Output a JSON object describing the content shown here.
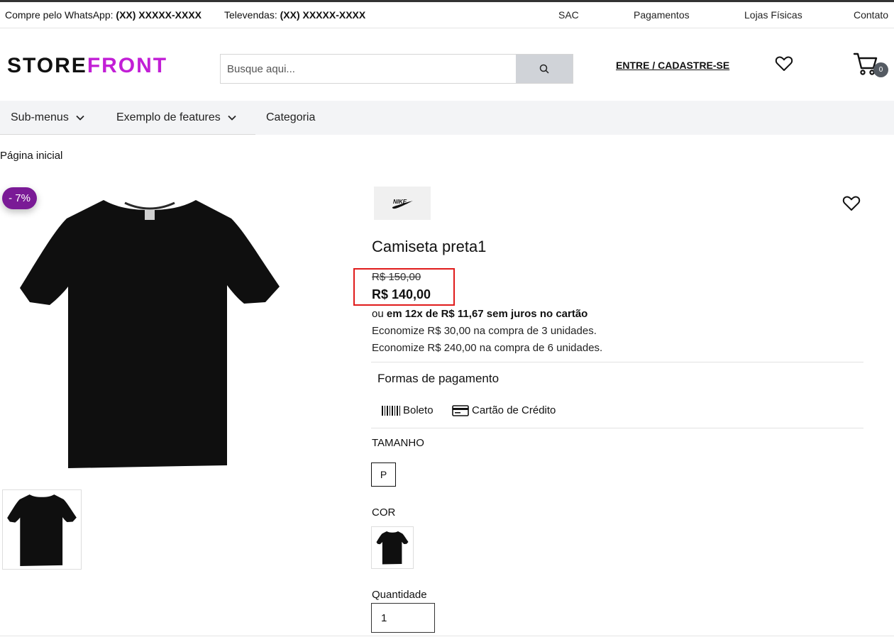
{
  "topbar": {
    "whatsapp_label": "Compre pelo WhatsApp:",
    "whatsapp_number": "(XX) XXXXX-XXXX",
    "televendas_label": "Televendas:",
    "televendas_number": "(XX) XXXXX-XXXX",
    "links": [
      "SAC",
      "Pagamentos",
      "Lojas Físicas",
      "Contato"
    ]
  },
  "header": {
    "logo_part1": "STORE",
    "logo_part2": "FRONT",
    "search_placeholder": "Busque aqui...",
    "login_label": "ENTRE / CADASTRE-SE",
    "cart_count": "0",
    "brand_color": "#c21fd6"
  },
  "menu": {
    "items": [
      {
        "label": "Sub-menus",
        "has_dropdown": true
      },
      {
        "label": "Exemplo de features",
        "has_dropdown": true
      },
      {
        "label": "Categoria",
        "has_dropdown": false
      }
    ]
  },
  "breadcrumb": "Página inicial",
  "product": {
    "discount_badge": "- 7%",
    "discount_color": "#7a1a96",
    "brand_logo": "NIKE",
    "title": "Camiseta preta1",
    "old_price": "R$ 150,00",
    "price": "R$ 140,00",
    "installments_prefix": "ou",
    "installments_text": "em 12x de R$ 11,67 sem juros no cartão",
    "savings": [
      "Economize R$ 30,00 na compra de 3 unidades.",
      "Economize R$ 240,00 na compra de 6 unidades."
    ],
    "payment_title": "Formas de pagamento",
    "payment_methods": [
      {
        "label": "Boleto",
        "icon": "barcode-icon"
      },
      {
        "label": "Cartão de Crédito",
        "icon": "credit-card-icon"
      }
    ],
    "size_label": "TAMANHO",
    "sizes": [
      "P"
    ],
    "color_label": "COR",
    "quantity_label": "Quantidade",
    "quantity_value": "1"
  }
}
